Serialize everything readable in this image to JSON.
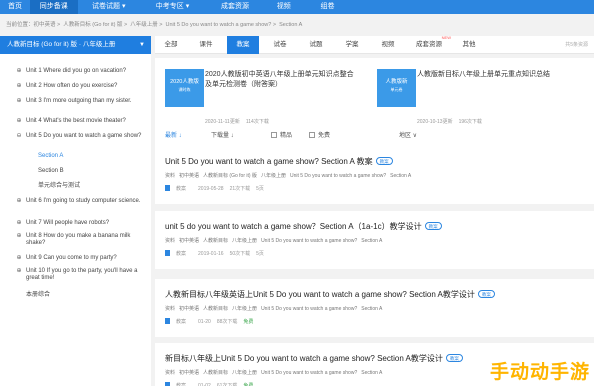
{
  "nav": {
    "items": [
      {
        "label": "首页",
        "width": 24
      },
      {
        "label": "同步备课",
        "width": 38,
        "active": true
      },
      {
        "label": "试卷试题 ▾",
        "width": 50
      },
      {
        "label": "中考专区 ▾",
        "width": 52
      },
      {
        "label": "成套资源",
        "width": 48
      },
      {
        "label": "视频",
        "width": 30
      },
      {
        "label": "组卷",
        "width": 40
      }
    ]
  },
  "breadcrumb": [
    "当前位置：初中英语 >",
    "人教新目标 (Go for it) 版 >",
    "八年级上册 >",
    "Unit 5 Do you want to watch a game show? >",
    "Section A"
  ],
  "sidebar": {
    "header": "人教新目标 (Go for it) 版 · 八年级上册",
    "items": [
      {
        "sym": "⊕",
        "text": "Unit 1 Where did you go on vacation?"
      },
      {
        "sym": "⊕",
        "text": "Unit 2 How often do you exercise?"
      },
      {
        "sym": "⊕",
        "text": "Unit 3 I'm more outgoing than my sister."
      },
      {
        "sym": "⊕",
        "text": "Unit 4 What's the best movie theater?"
      },
      {
        "sym": "⊖",
        "text": "Unit 5 Do you want to watch a game show?"
      },
      {
        "sym": "",
        "text": "Section A",
        "sub": true,
        "active": true
      },
      {
        "sym": "",
        "text": "Section B",
        "sub": true
      },
      {
        "sym": "",
        "text": "单元综合与测试",
        "sub": true
      },
      {
        "sym": "⊕",
        "text": "Unit 6 I'm going to study computer science."
      },
      {
        "sym": "⊕",
        "text": "Unit 7 Will people have robots?"
      },
      {
        "sym": "⊕",
        "text": "Unit 8 How do you make a banana milk shake?"
      },
      {
        "sym": "⊕",
        "text": "Unit 9 Can you come to my party?"
      },
      {
        "sym": "⊕",
        "text": "Unit 10 If you go to the party, you'll have a great time!"
      },
      {
        "sym": "",
        "text": "本册综合"
      }
    ]
  },
  "tabs": {
    "items": [
      "全部",
      "课件",
      "教案",
      "试卷",
      "试题",
      "学案",
      "视频",
      "成套资源",
      "其他"
    ],
    "active_index": 2,
    "new_tag": "NEW",
    "count": "共5条资源"
  },
  "featured": [
    {
      "cover": "2020人教版",
      "cover_sub": "课时练",
      "title": "2020人教版初中英语八年级上册单元知识点整合及单元检测卷（附答案）",
      "date": "2020-11-11更新",
      "views": "114次下载"
    },
    {
      "cover": "人教版新",
      "cover_sub": "单元卷",
      "title": "人教版新目标八年级上册单元重点知识总结",
      "date": "2020-10-13更新",
      "views": "196次下载"
    }
  ],
  "filters": {
    "latest": "最新 ↓",
    "downloads": "下载量 ↓",
    "premium": "精品",
    "free": "免费",
    "region": "地区 ∨"
  },
  "results": [
    {
      "title": "Unit 5 Do you want to watch a game show? Section A 教案",
      "badge": "教案",
      "path": [
        "资料",
        "初中英语",
        "人教新目标 (Go for it) 版",
        "八年级上册",
        "Unit 5 Do you want to watch a game show?",
        "Section A"
      ],
      "type": "教案",
      "date": "2019-05-28",
      "downloads": "21次下载",
      "size": "5页",
      "free": ""
    },
    {
      "title": "unit 5 do you want to watch a game show？Section A（1a-1c）教学设计",
      "badge": "教案",
      "path": [
        "资料",
        "初中英语",
        "人教新目标",
        "八年级上册",
        "Unit 5 Do you want to watch a game show?",
        "Section A"
      ],
      "type": "教案",
      "date": "2019-01-16",
      "downloads": "50次下载",
      "size": "5页",
      "free": ""
    },
    {
      "title": "人教新目标八年级英语上Unit 5 Do you want to watch a game show? Section A教学设计",
      "badge": "教案",
      "path": [
        "资料",
        "初中英语",
        "人教新目标",
        "八年级上册",
        "Unit 5 Do you want to watch a game show?",
        "Section A"
      ],
      "type": "教案",
      "date": "01-20",
      "downloads": "88次下载",
      "size": "",
      "free": "免费"
    },
    {
      "title": "新目标八年级上Unit 5 Do you want to watch a game show? Section A教学设计",
      "badge": "教案",
      "path": [
        "资料",
        "初中英语",
        "人教新目标",
        "八年级上册",
        "Unit 5 Do you want to watch a game show?",
        "Section A"
      ],
      "type": "教案",
      "date": "01-02",
      "downloads": "61次下载",
      "size": "",
      "free": "免费"
    }
  ],
  "watermark": "手动动手游"
}
